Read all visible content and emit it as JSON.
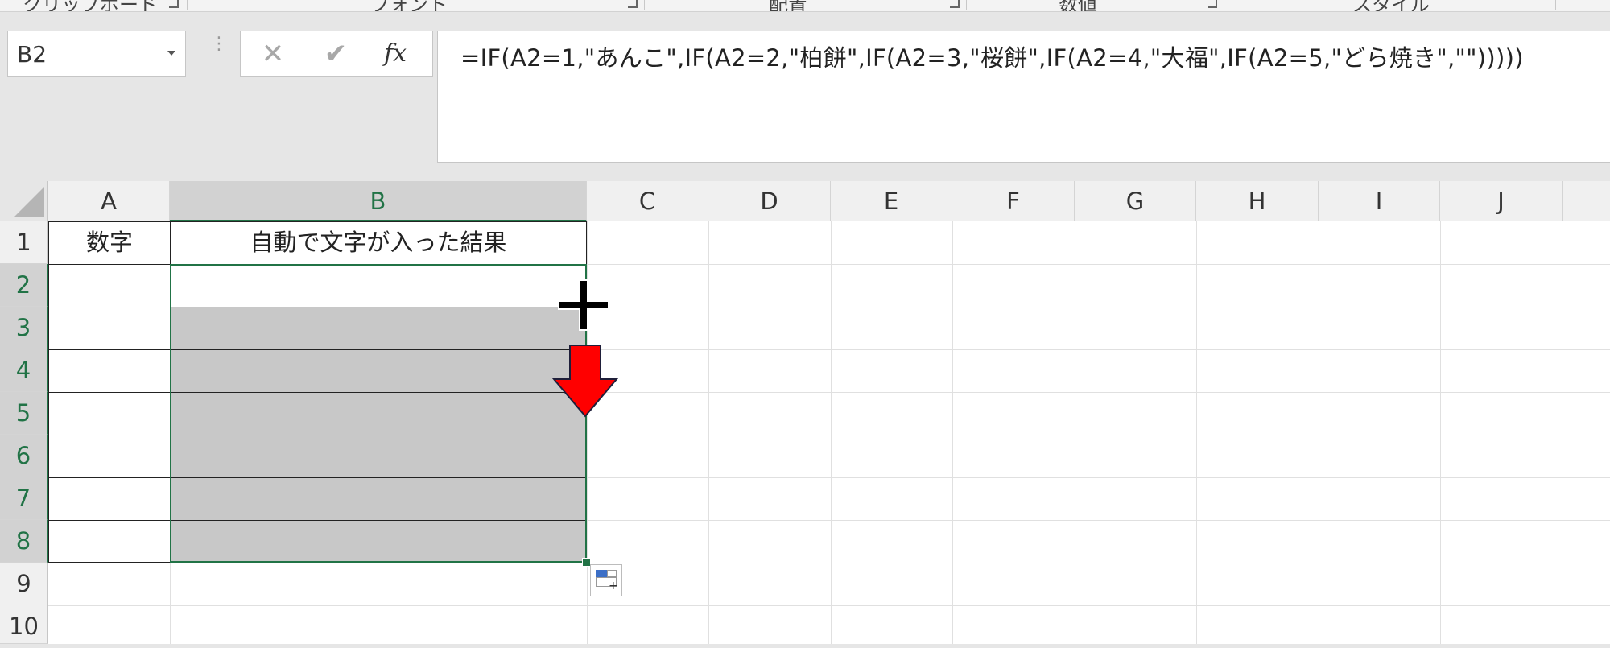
{
  "ribbon": {
    "groups": [
      "クリップボード",
      "フォント",
      "配置",
      "数値",
      "スタイル"
    ]
  },
  "formula_bar": {
    "name_box": "B2",
    "cancel_glyph": "✕",
    "enter_glyph": "✔",
    "fx_label": "fx",
    "formula": "=IF(A2=1,\"あんこ\",IF(A2=2,\"柏餅\",IF(A2=3,\"桜餅\",IF(A2=4,\"大福\",IF(A2=5,\"どら焼き\",\"\")))))"
  },
  "sheet": {
    "columns": [
      "A",
      "B",
      "C",
      "D",
      "E",
      "F",
      "G",
      "H",
      "I",
      "J"
    ],
    "rows": [
      "1",
      "2",
      "3",
      "4",
      "5",
      "6",
      "7",
      "8",
      "9",
      "10"
    ],
    "selected_column": "B",
    "selected_rows": [
      "2",
      "3",
      "4",
      "5",
      "6",
      "7",
      "8"
    ],
    "header_row": {
      "a1": "数字",
      "b1": "自動で文字が入った結果"
    },
    "data_rows": [
      {
        "a": "",
        "b": ""
      },
      {
        "a": "",
        "b": ""
      },
      {
        "a": "",
        "b": ""
      },
      {
        "a": "",
        "b": ""
      },
      {
        "a": "",
        "b": ""
      },
      {
        "a": "",
        "b": ""
      },
      {
        "a": "",
        "b": ""
      }
    ]
  },
  "colors": {
    "accent_green": "#217346",
    "selection_gray": "#c8c8c8",
    "arrow_red": "#ff0000"
  },
  "icons": {
    "cursor": "crosshair-cursor-icon",
    "arrow": "down-arrow-icon",
    "quick_analysis": "quick-analysis-icon"
  }
}
